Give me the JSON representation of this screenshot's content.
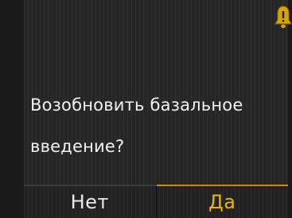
{
  "dialog": {
    "message_line1": "Возобновить базальное",
    "message_line2": "введение?",
    "alert_icon": "warning-bell-icon"
  },
  "softkeys": {
    "left_label": "Нет",
    "right_label": "Да"
  },
  "colors": {
    "background": "#262626",
    "text": "#f2f2f2",
    "accent": "#f0b400"
  }
}
